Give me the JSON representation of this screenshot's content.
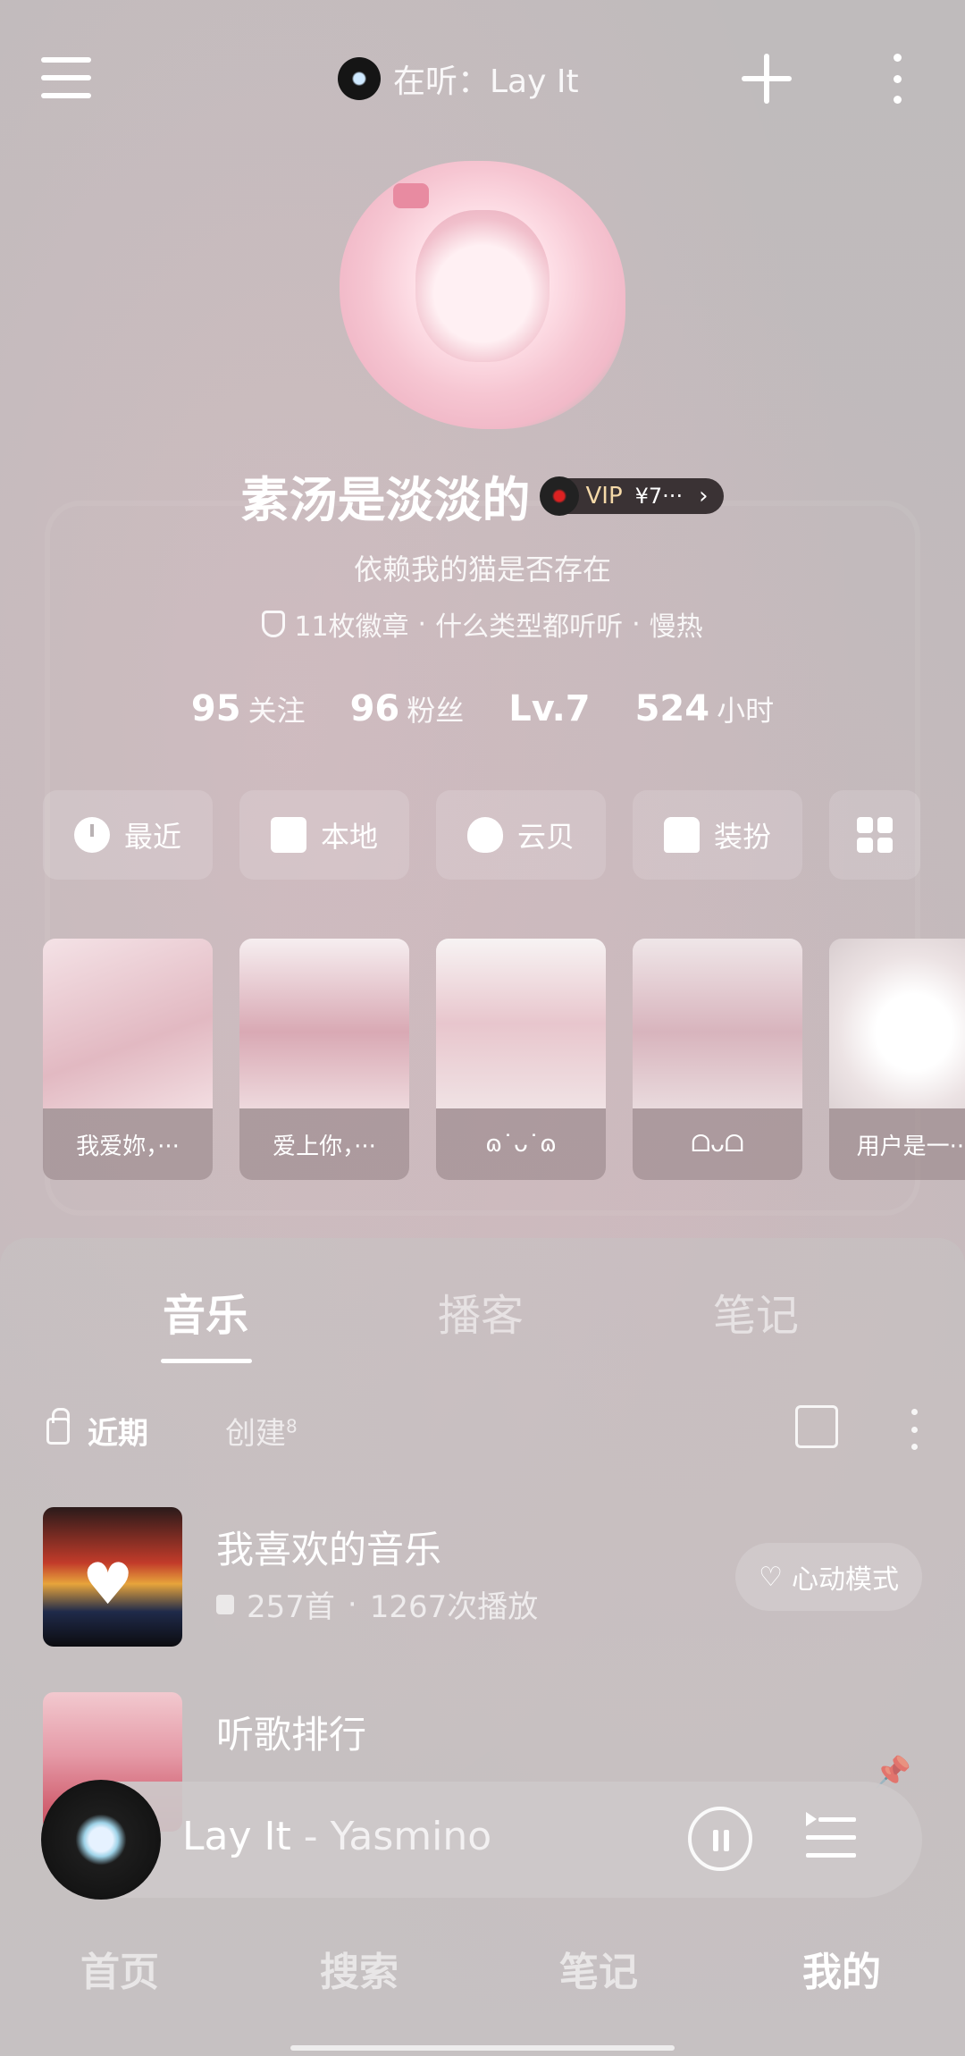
{
  "topbar": {
    "now_playing_label": "在听：Lay It"
  },
  "profile": {
    "username": "素汤是淡淡的",
    "vip_label": "VIP",
    "vip_price": "¥7···",
    "vip_arrow": "›",
    "signature": "依赖我的猫是否存在",
    "tags": [
      "11枚徽章",
      "·",
      "什么类型都听听",
      "·",
      "慢热"
    ]
  },
  "stats": [
    {
      "num": "95",
      "label": "关注"
    },
    {
      "num": "96",
      "label": "粉丝"
    },
    {
      "num": "Lv.7",
      "label": ""
    },
    {
      "num": "524",
      "label": "小时"
    }
  ],
  "quick_buttons": [
    {
      "label": "最近",
      "icon": "clock-icon"
    },
    {
      "label": "本地",
      "icon": "download-icon"
    },
    {
      "label": "云贝",
      "icon": "shell-icon"
    },
    {
      "label": "装扮",
      "icon": "shirt-icon"
    }
  ],
  "cards": [
    {
      "label": "我爱妳，···",
      "color": "#e9cdd3"
    },
    {
      "label": "爱上你，···",
      "color": "#e4c6cc"
    },
    {
      "label": "ɷ˙ᴗ˙ɷ",
      "color": "#ecd6da"
    },
    {
      "label": "ᗝᴗᗝ",
      "color": "#e6cfd4"
    },
    {
      "label": "用户是一···",
      "color": "#ece3e4"
    }
  ],
  "tabs": [
    "音乐",
    "播客",
    "笔记"
  ],
  "subtabs": {
    "recent": "近期",
    "created": "创建",
    "created_count": "8"
  },
  "playlists": [
    {
      "title": "我喜欢的音乐",
      "count": "257首",
      "sep": "·",
      "plays": "1267次播放",
      "action": "心动模式"
    },
    {
      "title": "听歌排行"
    }
  ],
  "mini_player": {
    "title": "Lay It",
    "sep": " - ",
    "artist": "Yasmino"
  },
  "bottom_nav": [
    "首页",
    "搜索",
    "笔记",
    "我的"
  ],
  "colors": {
    "accent": "#ffffff",
    "vip_bg": "#3a3234",
    "vip_gold": "#f5d9a8"
  }
}
